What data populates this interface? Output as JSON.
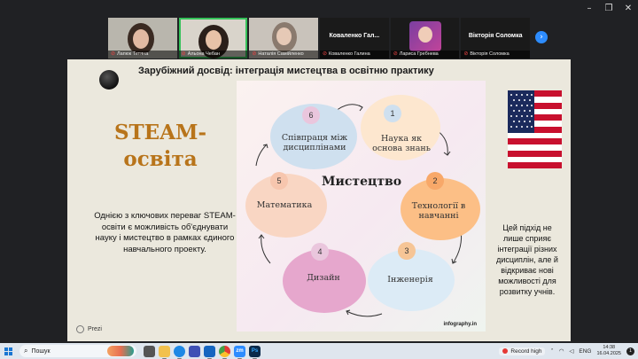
{
  "window_controls": {
    "minimize": "–",
    "restore": "❐",
    "close": "✕"
  },
  "participants": [
    {
      "name": "Лапюк Тетяна",
      "video": true
    },
    {
      "name": "Альона Чебан",
      "video": true,
      "active": true
    },
    {
      "name": "Наталія Самійленко",
      "video": true
    },
    {
      "name": "Коваленко Галина",
      "big_name": "Коваленко Гал...",
      "video": false
    },
    {
      "name": "Лариса Гребнева",
      "video": true
    },
    {
      "name": "Вікторія Соломка",
      "big_name": "Вікторія Соломка",
      "video": false
    }
  ],
  "strip_next_icon": "chevron-right-icon",
  "strip_next_glyph": "›",
  "slide": {
    "title": "Зарубіжний досвід: інтеграція мистецтва в освітню практику",
    "steam_line1": "STEAM-",
    "steam_line2": "освіта",
    "left_text": "Однією з ключових переваг STEAM-освіти є можливість об'єднувати науку і мистецтво в рамках єдиного навчального проекту.",
    "right_text": "Цей підхід не лише сприяє інтеграції різних дисциплін, але й відкриває нові можливості для розвитку учнів.",
    "prezi_label": "Prezi",
    "infographic": {
      "center": "Мистецтво",
      "source": "infography.in",
      "items": [
        {
          "num": "1",
          "label": "Наука  як основа знань",
          "color": "#fde7cf",
          "numcolor": "#cfe0ef"
        },
        {
          "num": "2",
          "label": "Технології  в навчанні",
          "color": "#fcbf86",
          "numcolor": "#f8a869"
        },
        {
          "num": "3",
          "label": "Інженерія",
          "color": "#dcebf6",
          "numcolor": "#f6c596"
        },
        {
          "num": "4",
          "label": "Дизайн",
          "color": "#e6a7cd",
          "numcolor": "#eac6dd"
        },
        {
          "num": "5",
          "label": "Математика",
          "color": "#f9d6c3",
          "numcolor": "#f7c6ae"
        },
        {
          "num": "6",
          "label": "Співпраця  між дисциплінами",
          "color": "#cfe0ef",
          "numcolor": "#eac6dd"
        }
      ]
    }
  },
  "taskbar": {
    "search_placeholder": "Пошук",
    "apps": [
      {
        "name": "file-explorer-icon",
        "color": "#f2c14e",
        "glyph": ""
      },
      {
        "name": "edge-icon",
        "color": "#1e88e5",
        "glyph": ""
      },
      {
        "name": "store-icon",
        "color": "#3f51b5",
        "glyph": ""
      },
      {
        "name": "mail-icon",
        "color": "#1565c0",
        "glyph": ""
      },
      {
        "name": "chrome-icon",
        "color": "#e53935",
        "glyph": ""
      },
      {
        "name": "zoom-icon",
        "color": "#2d8cff",
        "glyph": "zm"
      },
      {
        "name": "photoshop-icon",
        "color": "#0b2a4a",
        "glyph": "Ps"
      }
    ],
    "record_label": "Record high",
    "lang": "ENG",
    "time": "14:38",
    "date": "16.04.2025",
    "notifications": "1"
  }
}
